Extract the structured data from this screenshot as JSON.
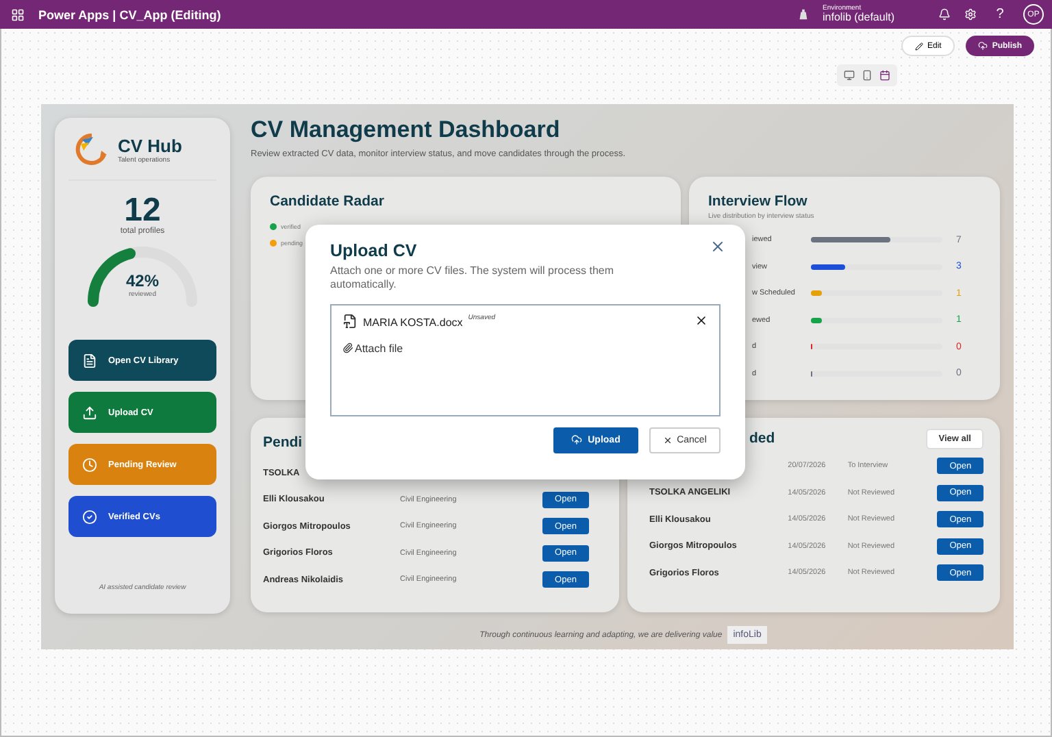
{
  "topbar": {
    "title": "Power Apps | CV_App (Editing)",
    "environment_label": "Environment",
    "environment": "infolib (default)",
    "help": "?",
    "avatar": "OP"
  },
  "actions": {
    "edit": "Edit",
    "publish": "Publish"
  },
  "sidebar": {
    "brand": "CV Hub",
    "tagline": "Talent operations",
    "total": "12",
    "total_label": "total profiles",
    "gauge": {
      "level": 0.42,
      "value": "42%",
      "label": "reviewed"
    },
    "buttons": [
      {
        "label": "Open CV Library",
        "kind": "library",
        "color": "#0f4a5a"
      },
      {
        "label": "Upload CV",
        "kind": "upload",
        "color": "#0f7a3e"
      },
      {
        "label": "Pending Review",
        "kind": "pending",
        "color": "#d9820f"
      },
      {
        "label": "Verified CVs",
        "kind": "verified",
        "color": "#1f4fd0"
      }
    ],
    "footer": "AI assisted candidate review"
  },
  "header": {
    "title": "CV Management Dashboard",
    "subtitle": "Review extracted CV data, monitor interview status, and move candidates through the process."
  },
  "radar": {
    "title": "Candidate Radar",
    "legend": [
      {
        "label": "verified",
        "color": "#16a34a"
      },
      {
        "label": "pending",
        "color": "#f59e0b"
      }
    ]
  },
  "flow": {
    "title": "Interview Flow",
    "subtitle": "Live distribution by interview status",
    "rows": [
      {
        "label": "iewed",
        "level": 0.6,
        "count": "7",
        "color": "#6b7280"
      },
      {
        "label": "view",
        "level": 0.26,
        "count": "3",
        "color": "#1d4ed8"
      },
      {
        "label": "w Scheduled",
        "level": 0.08,
        "count": "1",
        "color": "#e6a10a"
      },
      {
        "label": "ewed",
        "level": 0.08,
        "count": "1",
        "color": "#16a34a"
      },
      {
        "label": "d",
        "level": 0.01,
        "count": "0",
        "color": "#dc2626"
      },
      {
        "label": "d",
        "level": 0.01,
        "count": "0",
        "color": "#6b7280"
      }
    ]
  },
  "pending": {
    "title": "Pendi",
    "rows": [
      {
        "name": "TSOLKA"
      },
      {
        "name": "Elli Klousakou",
        "department": "Civil Engineering",
        "action": "Open"
      },
      {
        "name": "Giorgos Mitropoulos",
        "department": "Civil Engineering",
        "action": "Open"
      },
      {
        "name": "Grigorios Floros",
        "department": "Civil Engineering",
        "action": "Open"
      },
      {
        "name": "Andreas Nikolaidis",
        "department": "Civil Engineering",
        "action": "Open"
      }
    ]
  },
  "recent": {
    "title": "ded",
    "view_all": "View all",
    "rows": [
      {
        "date": "20/07/2026",
        "status": "To Interview",
        "action": "Open"
      },
      {
        "name": "TSOLKA ANGELIKI",
        "date": "14/05/2026",
        "status": "Not Reviewed",
        "action": "Open"
      },
      {
        "name": "Elli Klousakou",
        "date": "14/05/2026",
        "status": "Not Reviewed",
        "action": "Open"
      },
      {
        "name": "Giorgos Mitropoulos",
        "date": "14/05/2026",
        "status": "Not Reviewed",
        "action": "Open"
      },
      {
        "name": "Grigorios Floros",
        "date": "14/05/2026",
        "status": "Not Reviewed",
        "action": "Open"
      }
    ]
  },
  "footer": {
    "text": "Through continuous learning and adapting, we are delivering value",
    "logo": "infoLib"
  },
  "dialog": {
    "title": "Upload CV",
    "description": "Attach one or more CV files. The system will process them automatically.",
    "files": [
      {
        "name": "MARIA KOSTA.docx",
        "status": "Unsaved"
      }
    ],
    "attach": "Attach file",
    "upload": "Upload",
    "cancel": "Cancel"
  }
}
